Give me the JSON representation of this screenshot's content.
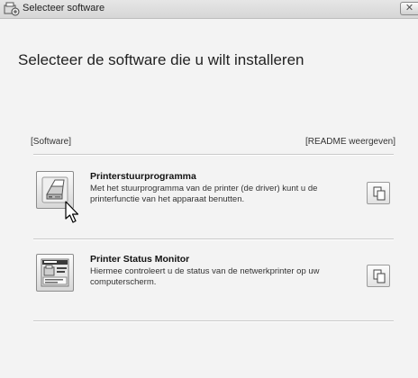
{
  "window": {
    "title": "Selecteer software",
    "close_glyph": "✕"
  },
  "header": {
    "heading": "Selecteer de software die u wilt installeren"
  },
  "labels": {
    "software": "[Software]",
    "readme": "[README weergeven]"
  },
  "items": [
    {
      "title": "Printerstuurprogramma",
      "description": "Met het stuurprogramma van de printer (de driver) kunt u de printerfunctie van het apparaat benutten.",
      "icon": "printer-icon"
    },
    {
      "title": "Printer Status Monitor",
      "description": "Hiermee controleert u de status van de netwerkprinter op uw computerscherm.",
      "icon": "status-monitor-icon"
    }
  ],
  "icons": {
    "readme": "document-copy-icon",
    "cursor": "mouse-pointer-icon"
  },
  "colors": {
    "background": "#f3f3f3",
    "text": "#222222"
  }
}
